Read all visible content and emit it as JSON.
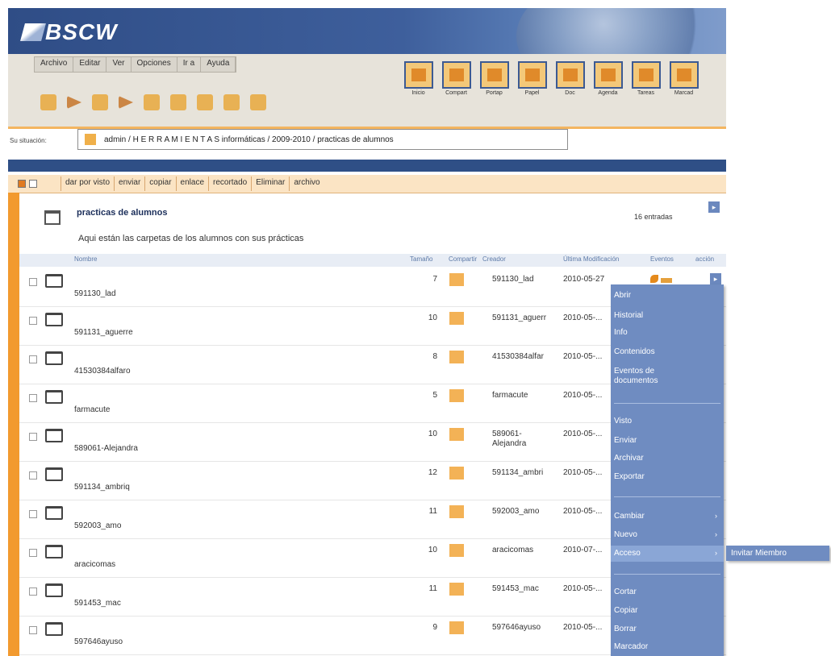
{
  "header": {
    "logo_text": "BSCW"
  },
  "menu": [
    "Archivo",
    "Editar",
    "Ver",
    "Opciones",
    "Ir a",
    "Ayuda"
  ],
  "nav_buttons": [
    "Inicio",
    "Compart",
    "Portap",
    "Papel",
    "Doc",
    "Agenda",
    "Tareas",
    "Marcad"
  ],
  "location": {
    "label": "Su situación:",
    "path": "admin / H E R R A M I E N T A S informáticas / 2009-2010 / practicas de alumnos"
  },
  "actions": [
    "dar por visto",
    "enviar",
    "copiar",
    "enlace",
    "recortado",
    "Eliminar",
    "archivo"
  ],
  "folder": {
    "title": "practicas de alumnos",
    "entries": "16 entradas",
    "description": "Aqui están las carpetas de los alumnos con sus prácticas"
  },
  "columns": {
    "name": "Nombre",
    "size": "Tamaño",
    "share": "Compartir",
    "creator": "Creador",
    "modified": "Última Modificación",
    "events": "Eventos",
    "action": "acción"
  },
  "rows": [
    {
      "name": "591130_lad",
      "size": "7",
      "creator": "591130_lad",
      "date": "2010-05-27"
    },
    {
      "name": "591131_aguerre",
      "size": "10",
      "creator": "591131_aguerr",
      "date": "2010-05-..."
    },
    {
      "name": "41530384alfaro",
      "size": "8",
      "creator": "41530384alfar",
      "date": "2010-05-..."
    },
    {
      "name": "farmacute",
      "size": "5",
      "creator": "farmacute",
      "date": "2010-05-..."
    },
    {
      "name": "589061-Alejandra",
      "size": "10",
      "creator": "589061-\nAlejandra",
      "date": "2010-05-..."
    },
    {
      "name": "591134_ambriq",
      "size": "12",
      "creator": "591134_ambri",
      "date": "2010-05-..."
    },
    {
      "name": "592003_amo",
      "size": "11",
      "creator": "592003_amo",
      "date": "2010-05-..."
    },
    {
      "name": "aracicomas",
      "size": "10",
      "creator": "aracicomas",
      "date": "2010-07-..."
    },
    {
      "name": "591453_mac",
      "size": "11",
      "creator": "591453_mac",
      "date": "2010-05-..."
    },
    {
      "name": "597646ayuso",
      "size": "9",
      "creator": "597646ayuso",
      "date": "2010-05-..."
    }
  ],
  "context_menu": {
    "items": [
      "Abrir",
      "Historial",
      "Info",
      "Contenidos",
      "Eventos de documentos",
      "Visto",
      "Enviar",
      "Archivar",
      "Exportar",
      "Cambiar",
      "Nuevo",
      "Acceso",
      "Cortar",
      "Copiar",
      "Borrar",
      "Marcador"
    ],
    "highlighted": "Acceso",
    "submenu": "Invitar Miembro"
  },
  "colors": {
    "banner": "#2f4d86",
    "accent_orange": "#f29a2f",
    "menu_blue": "#6f8cc1"
  }
}
